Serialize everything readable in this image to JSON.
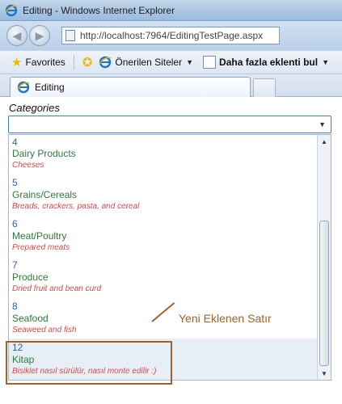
{
  "window": {
    "title": "Editing - Windows Internet Explorer"
  },
  "address_bar": {
    "url": "http://localhost:7964/EditingTestPage.aspx"
  },
  "favorites_bar": {
    "favorites_label": "Favorites",
    "suggested_sites_label": "Önerilen Siteler",
    "more_addons_label": "Daha fazla eklenti bul"
  },
  "tabs": [
    {
      "label": "Editing"
    }
  ],
  "page": {
    "categories_label": "Categories",
    "combo_value": "",
    "rows": [
      {
        "id": "4",
        "name": "Dairy Products",
        "description": "Cheeses"
      },
      {
        "id": "5",
        "name": "Grains/Cereals",
        "description": "Breads, crackers, pasta, and cereal"
      },
      {
        "id": "6",
        "name": "Meat/Poultry",
        "description": "Prepared meats"
      },
      {
        "id": "7",
        "name": "Produce",
        "description": "Dried fruit and bean curd"
      },
      {
        "id": "8",
        "name": "Seafood",
        "description": "Seaweed and fish"
      },
      {
        "id": "12",
        "name": "Kitap",
        "description": "Bisiklet nasıl sürülür, nasıl monte edilir :)"
      }
    ]
  },
  "annotation": {
    "text": "Yeni Eklenen Satır",
    "color": "#a0622a"
  }
}
